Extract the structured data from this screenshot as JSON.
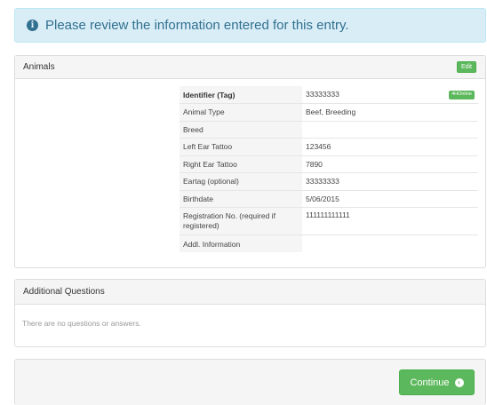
{
  "alert": {
    "icon": "info-circle-icon",
    "message": "Please review the information entered for this entry."
  },
  "animals_panel": {
    "title": "Animals",
    "edit_label": "Edit",
    "rows": [
      {
        "label": "Identifier (Tag)",
        "value": "33333333",
        "badge": "4HOnline"
      },
      {
        "label": "Animal Type",
        "value": "Beef, Breeding"
      },
      {
        "label": "Breed",
        "value": ""
      },
      {
        "label": "Left Ear Tattoo",
        "value": "123456"
      },
      {
        "label": "Right Ear Tattoo",
        "value": "7890"
      },
      {
        "label": "Eartag (optional)",
        "value": "33333333"
      },
      {
        "label": "Birthdate",
        "value": "5/06/2015"
      },
      {
        "label": "Registration No. (required if registered)",
        "value": "111111111111"
      },
      {
        "label": "Addl. Information",
        "value": ""
      }
    ]
  },
  "questions_panel": {
    "title": "Additional Questions",
    "empty_text": "There are no questions or answers."
  },
  "footer": {
    "continue_label": "Continue",
    "continue_icon": "arrow-circle-right-icon"
  },
  "colors": {
    "info_bg": "#d9edf7",
    "info_text": "#31708f",
    "success": "#5cb85c",
    "panel_heading_bg": "#f5f5f5"
  }
}
